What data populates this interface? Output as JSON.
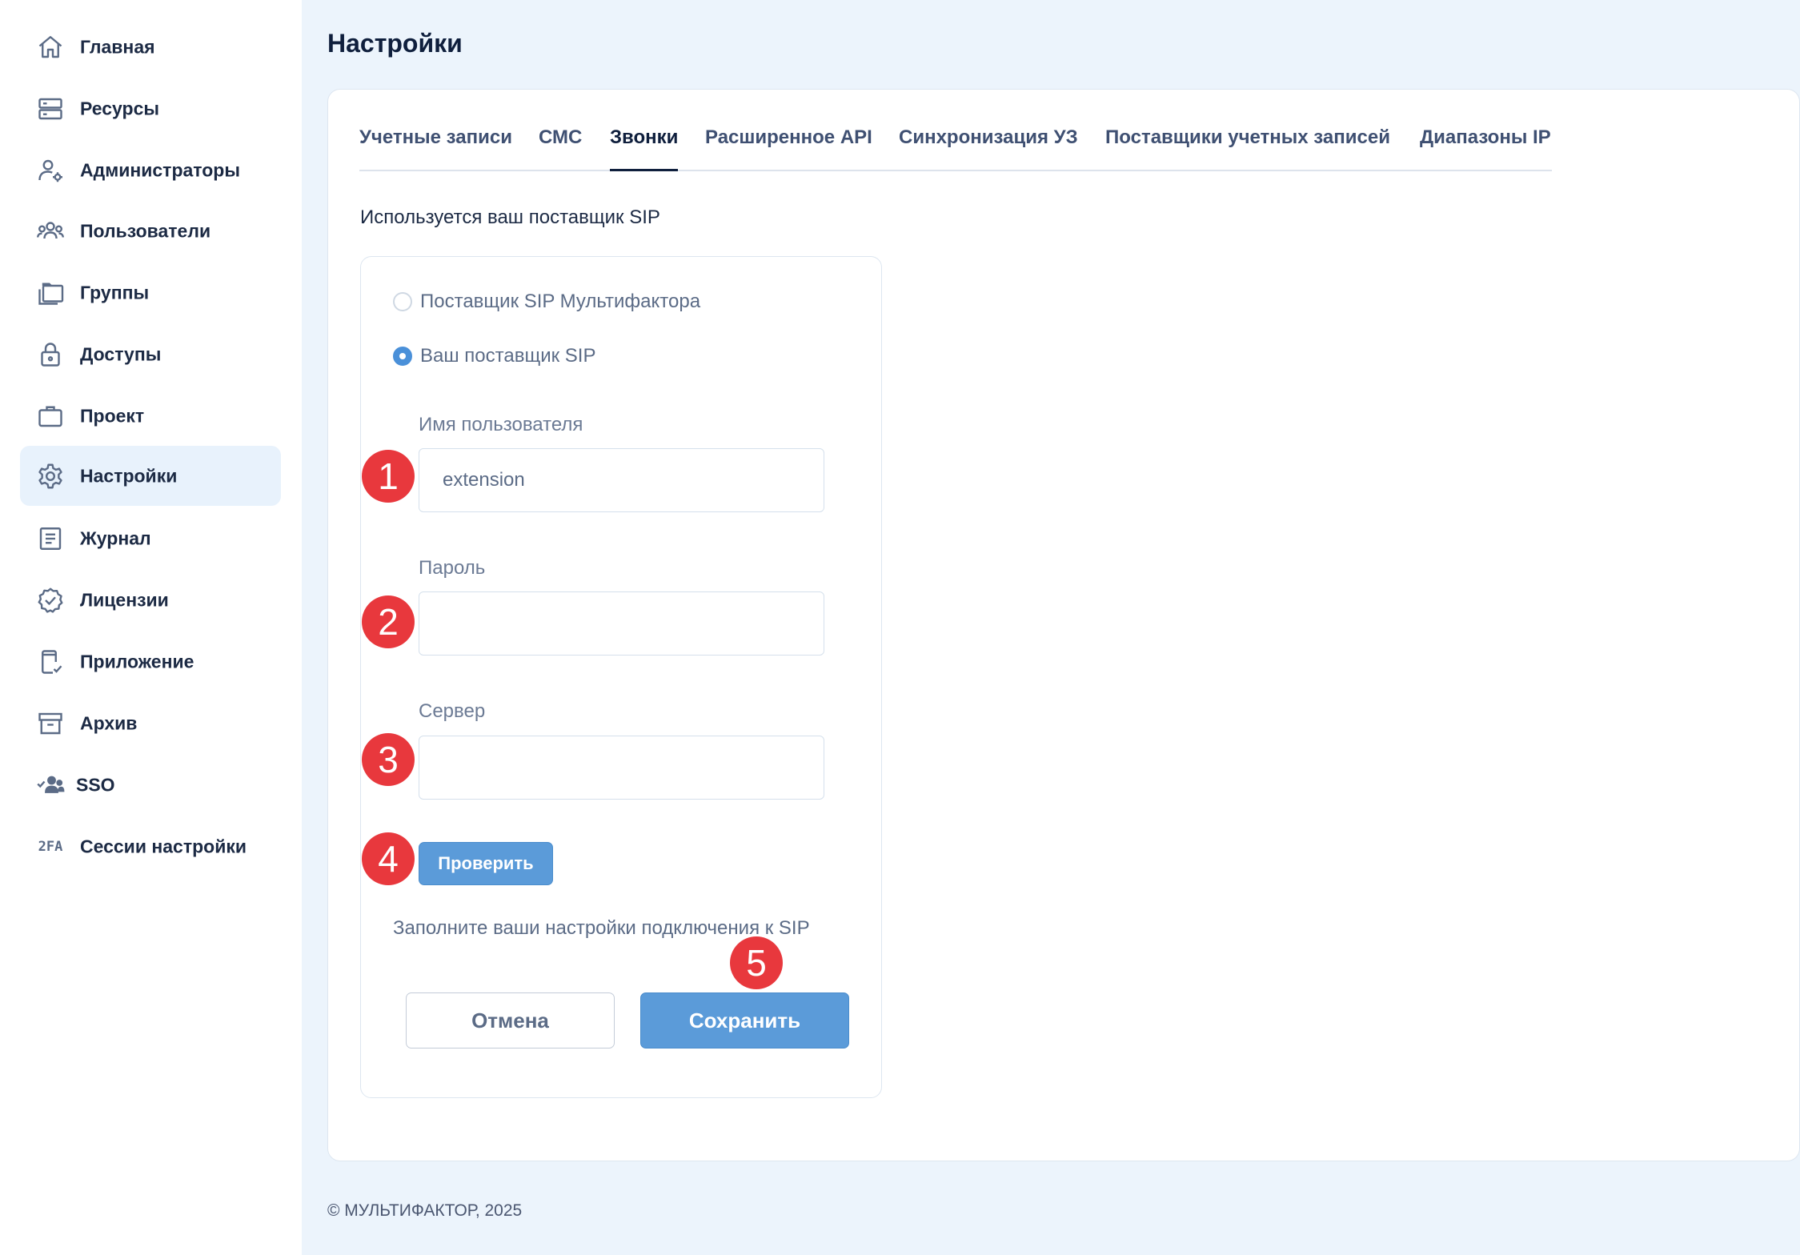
{
  "sidebar": {
    "items": [
      {
        "label": "Главная",
        "icon": "home-icon"
      },
      {
        "label": "Ресурсы",
        "icon": "server-icon"
      },
      {
        "label": "Администраторы",
        "icon": "user-gear-icon"
      },
      {
        "label": "Пользователи",
        "icon": "users-icon"
      },
      {
        "label": "Группы",
        "icon": "folders-icon"
      },
      {
        "label": "Доступы",
        "icon": "lock-icon"
      },
      {
        "label": "Проект",
        "icon": "briefcase-icon"
      },
      {
        "label": "Настройки",
        "icon": "gear-icon",
        "active": true
      },
      {
        "label": "Журнал",
        "icon": "journal-icon"
      },
      {
        "label": "Лицензии",
        "icon": "badge-check-icon"
      },
      {
        "label": "Приложение",
        "icon": "phone-check-icon"
      },
      {
        "label": "Архив",
        "icon": "archive-icon"
      },
      {
        "label": "SSO",
        "icon": "sso-users-icon"
      },
      {
        "label": "Сессии настройки",
        "icon": "2fa-icon",
        "icon_text": "2FA"
      }
    ]
  },
  "page": {
    "title": "Настройки"
  },
  "tabs": [
    {
      "label": "Учетные записи"
    },
    {
      "label": "СМС"
    },
    {
      "label": "Звонки",
      "active": true
    },
    {
      "label": "Расширенное API"
    },
    {
      "label": "Синхронизация УЗ"
    },
    {
      "label": "Поставщики учетных записей"
    },
    {
      "label": "Диапазоны IP"
    }
  ],
  "sip": {
    "subtitle": "Используется ваш поставщик SIP",
    "option_multifactor": "Поставщик SIP Мультифактора",
    "option_own": "Ваш поставщик SIP",
    "selected": "own",
    "username_label": "Имя пользователя",
    "username_value": "extension",
    "password_label": "Пароль",
    "password_value": "",
    "server_label": "Сервер",
    "server_value": "",
    "check_button": "Проверить",
    "hint": "Заполните ваши настройки подключения к SIP",
    "cancel_button": "Отмена",
    "save_button": "Сохранить"
  },
  "badges": [
    "1",
    "2",
    "3",
    "4",
    "5"
  ],
  "colors": {
    "accent": "#5b9bd9",
    "badge": "#e8383d",
    "background": "#ecf4fc",
    "active_nav": "#e8f2fc"
  },
  "footer": {
    "text": "© МУЛЬТИФАКТОР, 2025"
  }
}
